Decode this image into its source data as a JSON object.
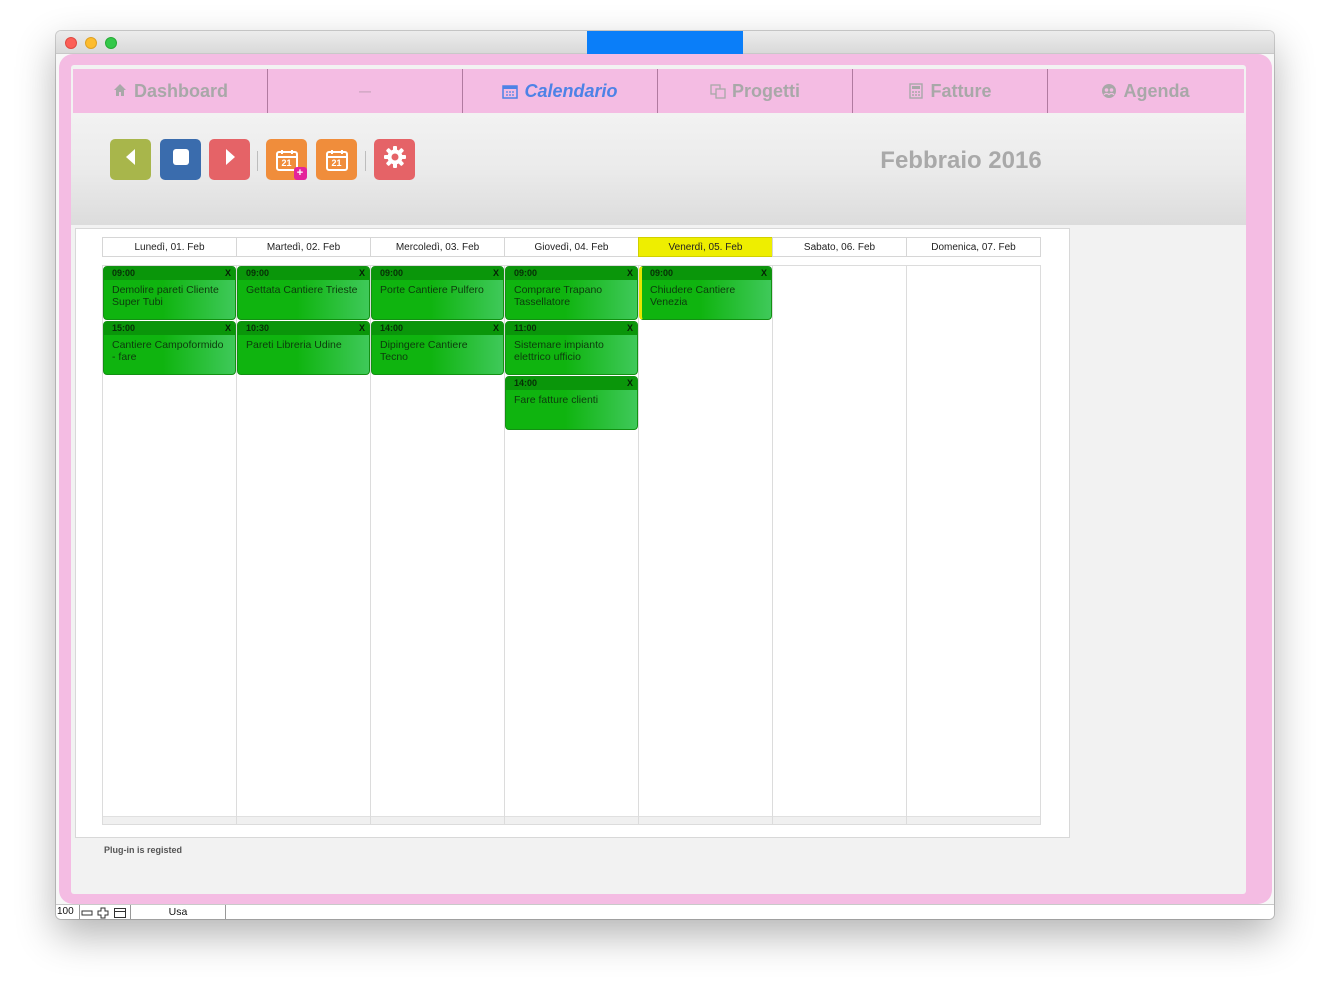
{
  "nav": {
    "tabs": [
      {
        "label": "Dashboard",
        "icon": "home-icon"
      },
      {
        "label": "—",
        "icon": ""
      },
      {
        "label": "Calendario",
        "icon": "calendar-icon"
      },
      {
        "label": "Progetti",
        "icon": "copy-icon"
      },
      {
        "label": "Fatture",
        "icon": "calculator-icon"
      },
      {
        "label": "Agenda",
        "icon": "contacts-icon"
      }
    ],
    "active_index": 2
  },
  "toolbar": {
    "buttons": [
      "prev-arrow-icon",
      "stop-icon",
      "next-arrow-icon",
      "calendar-add-icon",
      "calendar-icon",
      "gear-icon"
    ],
    "calendar_icon_number": "21",
    "month_label": "Febbraio 2016"
  },
  "colors": {
    "frame_pink": "#f4bce3",
    "accent_blue": "#4d82e6",
    "event_green": "#0fb40f",
    "today_yellow": "#eeee00"
  },
  "calendar": {
    "days": [
      {
        "header": "Lunedì, 01. Feb",
        "today": false,
        "events": [
          {
            "time": "09:00",
            "title": "Demolire pareti Cliente Super Tubi"
          },
          {
            "time": "15:00",
            "title": "Cantiere Campoformido - fare"
          }
        ]
      },
      {
        "header": "Martedì, 02. Feb",
        "today": false,
        "events": [
          {
            "time": "09:00",
            "title": "Gettata Cantiere Trieste"
          },
          {
            "time": "10:30",
            "title": "Pareti Libreria Udine"
          }
        ]
      },
      {
        "header": "Mercoledì, 03. Feb",
        "today": false,
        "events": [
          {
            "time": "09:00",
            "title": "Porte Cantiere Pulfero"
          },
          {
            "time": "14:00",
            "title": "Dipingere Cantiere Tecno"
          }
        ]
      },
      {
        "header": "Giovedì, 04. Feb",
        "today": false,
        "events": [
          {
            "time": "09:00",
            "title": "Comprare Trapano Tassellatore"
          },
          {
            "time": "11:00",
            "title": "Sistemare impianto elettrico ufficio"
          },
          {
            "time": "14:00",
            "title": "Fare fatture clienti"
          }
        ]
      },
      {
        "header": "Venerdì, 05. Feb",
        "today": true,
        "events": [
          {
            "time": "09:00",
            "title": "Chiudere Cantiere Venezia"
          }
        ]
      },
      {
        "header": "Sabato, 06. Feb",
        "today": false,
        "events": []
      },
      {
        "header": "Domenica, 07. Feb",
        "today": false,
        "events": []
      }
    ],
    "close_label": "X"
  },
  "footer": {
    "plugin_status": "Plug-in is registed"
  },
  "statusbar": {
    "zoom": "100",
    "layout": "Usa"
  }
}
